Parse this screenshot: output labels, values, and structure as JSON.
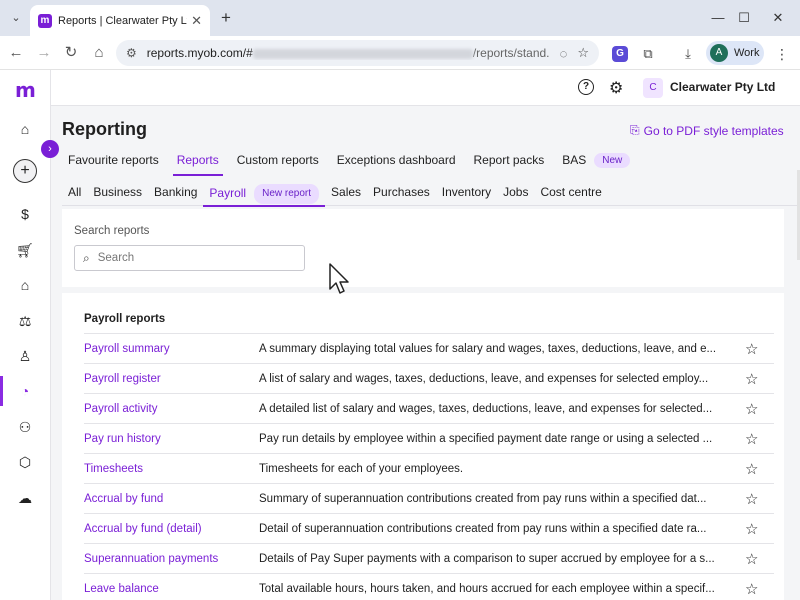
{
  "browser": {
    "tab_title": "Reports | Clearwater Pty Ltd | M",
    "favicon_letter": "m",
    "url_host": "reports.myob.com/#",
    "url_path": "/reports/stand...",
    "profile_initial": "A",
    "profile_label": "Work",
    "extension_label": "G"
  },
  "app": {
    "logo": "m",
    "business_initial": "C",
    "business_name": "Clearwater Pty Ltd",
    "page_title": "Reporting",
    "pdf_link": "Go to PDF style templates",
    "main_tabs": [
      {
        "label": "Favourite reports"
      },
      {
        "label": "Reports"
      },
      {
        "label": "Custom reports"
      },
      {
        "label": "Exceptions dashboard"
      },
      {
        "label": "Report packs"
      },
      {
        "label": "BAS",
        "badge": "New"
      }
    ],
    "sub_tabs": [
      {
        "label": "All"
      },
      {
        "label": "Business"
      },
      {
        "label": "Banking"
      },
      {
        "label": "Payroll",
        "badge": "New report"
      },
      {
        "label": "Sales"
      },
      {
        "label": "Purchases"
      },
      {
        "label": "Inventory"
      },
      {
        "label": "Jobs"
      },
      {
        "label": "Cost centre"
      }
    ],
    "search": {
      "label": "Search reports",
      "placeholder": "Search"
    },
    "section_title": "Payroll reports",
    "reports": [
      {
        "name": "Payroll summary",
        "desc": "A summary displaying total values for salary and wages, taxes, deductions, leave, and e..."
      },
      {
        "name": "Payroll register",
        "desc": "A list of salary and wages, taxes, deductions, leave, and expenses for selected employ..."
      },
      {
        "name": "Payroll activity",
        "desc": "A detailed list of salary and wages, taxes, deductions, leave, and expenses for selected..."
      },
      {
        "name": "Pay run history",
        "desc": "Pay run details by employee within a specified payment date range or using a selected ..."
      },
      {
        "name": "Timesheets",
        "desc": "Timesheets for each of your employees."
      },
      {
        "name": "Accrual by fund",
        "desc": "Summary of superannuation contributions created from pay runs within a specified dat..."
      },
      {
        "name": "Accrual by fund (detail)",
        "desc": "Detail of superannuation contributions created from pay runs within a specified date ra..."
      },
      {
        "name": "Superannuation payments",
        "desc": "Details of Pay Super payments with a comparison to super accrued by employee for a s..."
      },
      {
        "name": "Leave balance",
        "desc": "Total available hours, hours taken, and hours accrued for each employee within a specif..."
      }
    ],
    "accent_color": "#7a1fd6"
  }
}
